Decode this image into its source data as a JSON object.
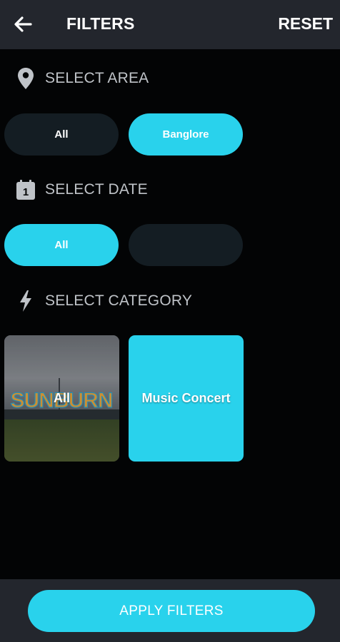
{
  "header": {
    "title": "FILTERS",
    "reset_label": "RESET",
    "back_icon": "arrow-left-icon"
  },
  "sections": {
    "area": {
      "label": "SELECT AREA",
      "icon": "location-pin-icon",
      "options": [
        {
          "label": "All",
          "selected": false
        },
        {
          "label": "Banglore",
          "selected": true
        }
      ]
    },
    "date": {
      "label": "SELECT DATE",
      "icon": "calendar-icon",
      "calendar_day": "1",
      "options": [
        {
          "label": "All",
          "selected": true
        },
        {
          "label": "",
          "selected": false
        }
      ]
    },
    "category": {
      "label": "SELECT CATEGORY",
      "icon": "lightning-icon",
      "options": [
        {
          "label": "All",
          "selected": false,
          "photo_sign": "SUNBURN"
        },
        {
          "label": "Music Concert",
          "selected": true
        }
      ]
    }
  },
  "apply_label": "APPLY FILTERS",
  "colors": {
    "accent": "#29d2ec",
    "background": "#030405",
    "appbar": "#23262d",
    "chip_unselected": "#141d23",
    "label_text": "#bfc3c8"
  }
}
